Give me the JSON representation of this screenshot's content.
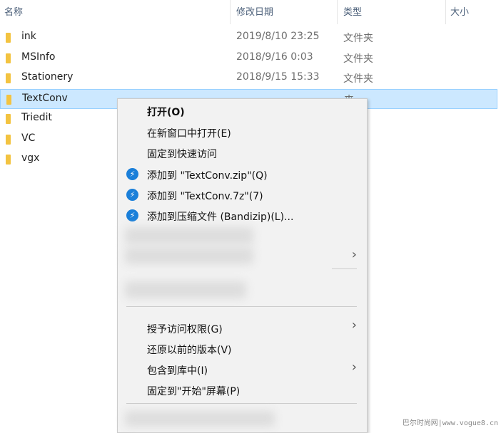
{
  "header": {
    "name": "名称",
    "date": "修改日期",
    "type": "类型",
    "size": "大小"
  },
  "rows": [
    {
      "name": "ink",
      "date": "2019/8/10 23:25",
      "type": "文件夹"
    },
    {
      "name": "MSInfo",
      "date": "2018/9/16 0:03",
      "type": "文件夹"
    },
    {
      "name": "Stationery",
      "date": "2018/9/15 15:33",
      "type": "文件夹"
    },
    {
      "name": "TextConv",
      "date": "",
      "type": "夹",
      "selected": true
    },
    {
      "name": "Triedit",
      "date": "",
      "type": "夹"
    },
    {
      "name": "VC",
      "date": "",
      "type": "夹"
    },
    {
      "name": "vgx",
      "date": "",
      "type": "夹"
    }
  ],
  "menu": {
    "open": "打开(O)",
    "open_new_window": "在新窗口中打开(E)",
    "pin_quick_access": "固定到快速访问",
    "add_zip": "添加到 \"TextConv.zip\"(Q)",
    "add_7z": "添加到 \"TextConv.7z\"(7)",
    "add_bandizip": "添加到压缩文件 (Bandizip)(L)...",
    "grant_access": "授予访问权限(G)",
    "restore_versions": "还原以前的版本(V)",
    "include_library": "包含到库中(I)",
    "pin_start": "固定到\"开始\"屏幕(P)"
  },
  "watermark": "巴尔时尚网|www.vogue8.cn",
  "colors": {
    "selection": "#cce8ff",
    "menu_bg": "#f2f2f2",
    "bandizip": "#1a7fd9"
  }
}
